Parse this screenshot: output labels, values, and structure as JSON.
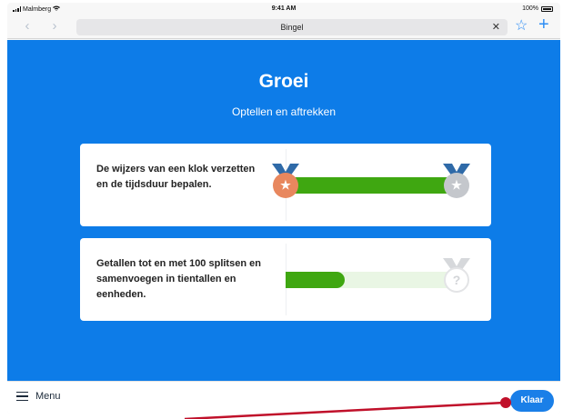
{
  "status": {
    "carrier": "Malmberg",
    "time": "9:41 AM",
    "battery": "100%"
  },
  "browser": {
    "url": "Bingel",
    "close_glyph": "✕",
    "back_glyph": "‹",
    "forward_glyph": "›",
    "star_glyph": "☆",
    "plus_glyph": "+"
  },
  "page": {
    "title": "Groei",
    "subtitle": "Optellen en aftrekken"
  },
  "skills": [
    {
      "text": "De wijzers van een klok verzetten en de tijdsduur bepalen.",
      "progress": 1.0,
      "start_medal": "bronze-star",
      "end_medal": "silver-star"
    },
    {
      "text": "Getallen tot en met 100 splitsen en samenvoegen in tientallen en eenheden.",
      "progress": 0.33,
      "end_medal": "unknown"
    }
  ],
  "bottom": {
    "menu_label": "Menu",
    "done_label": "Klaar"
  },
  "colors": {
    "app_bg": "#0d7ce8",
    "progress": "#3fa711",
    "track": "#e9f6e4",
    "bronze": "#e8875e",
    "silver": "#c4c7cc",
    "ribbon": "#2f6aa8",
    "annotation": "#c0102a"
  },
  "icons": {
    "back": "chevron-left-icon",
    "forward": "chevron-right-icon",
    "clear": "close-icon",
    "bookmark": "star-icon",
    "new_tab": "plus-icon",
    "menu": "hamburger-icon",
    "medal_star": "star-icon",
    "medal_unknown": "question-icon"
  }
}
